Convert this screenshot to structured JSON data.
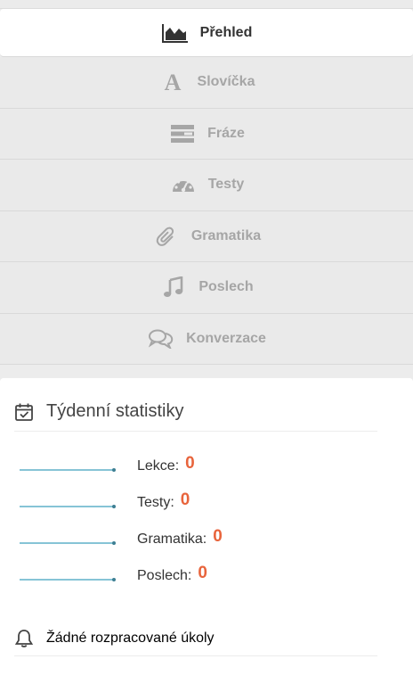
{
  "nav": {
    "items": [
      {
        "label": "Přehled",
        "icon": "area-chart-icon",
        "active": true
      },
      {
        "label": "Slovíčka",
        "icon": "letter-a-icon",
        "active": false
      },
      {
        "label": "Fráze",
        "icon": "lines-icon",
        "active": false
      },
      {
        "label": "Testy",
        "icon": "dashboard-icon",
        "active": false
      },
      {
        "label": "Gramatika",
        "icon": "paperclip-icon",
        "active": false
      },
      {
        "label": "Poslech",
        "icon": "music-note-icon",
        "active": false
      },
      {
        "label": "Konverzace",
        "icon": "chat-bubbles-icon",
        "active": false
      }
    ]
  },
  "weekly": {
    "title": "Týdenní statistiky",
    "icon": "calendar-check-icon",
    "stats": [
      {
        "label": "Lekce:",
        "value": "0"
      },
      {
        "label": "Testy:",
        "value": "0"
      },
      {
        "label": "Gramatika:",
        "value": "0"
      },
      {
        "label": "Poslech:",
        "value": "0"
      }
    ]
  },
  "tasks": {
    "title": "Žádné rozpracované úkoly",
    "icon": "bell-icon"
  },
  "colors": {
    "accent_value": "#e8643c",
    "sparkline": "#5fb0c9",
    "nav_inactive": "#a6a6a6"
  }
}
